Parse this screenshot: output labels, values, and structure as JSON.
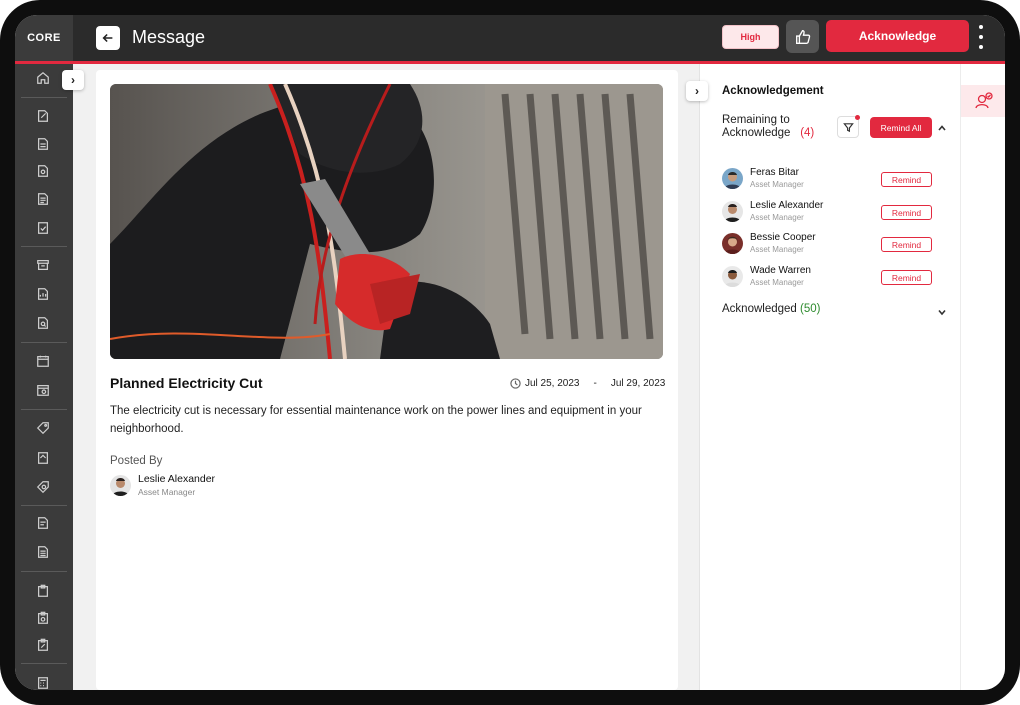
{
  "brand": {
    "logo_text": "CORE",
    "accent": "#e2293f"
  },
  "header": {
    "title": "Message",
    "priority": "High",
    "acknowledge_label": "Acknowledge"
  },
  "sidebar": {
    "icons": [
      "home-icon",
      "edit-document-icon",
      "document-icon",
      "document-settings-icon",
      "document-list-icon",
      "document-check-icon",
      "archive-icon",
      "report-icon",
      "report-search-icon",
      "calendar-document-icon",
      "calendar-search-icon",
      "tag-edit-icon",
      "tag-document-icon",
      "tag-settings-icon",
      "list-edit-icon",
      "list-icon",
      "clipboard-icon",
      "clipboard-search-icon",
      "clipboard-edit-icon",
      "calculator-icon"
    ]
  },
  "post": {
    "title": "Planned Electricity Cut",
    "start_date": "Jul 25, 2023",
    "date_separator": "-",
    "end_date": "Jul 29, 2023",
    "body": "The electricity cut is necessary for essential maintenance work on the power lines and equipment in your neighborhood.",
    "posted_by_label": "Posted By",
    "author": {
      "name": "Leslie Alexander",
      "role": "Asset Manager"
    }
  },
  "acknowledgement": {
    "title": "Acknowledgement",
    "remaining_label": "Remaining to Acknowledge",
    "remaining_count": "(4)",
    "remind_all_label": "Remind All",
    "remind_label": "Remind",
    "people": [
      {
        "name": "Feras Bitar",
        "role": "Asset Manager"
      },
      {
        "name": "Leslie Alexander",
        "role": "Asset Manager"
      },
      {
        "name": "Bessie Cooper",
        "role": "Asset Manager"
      },
      {
        "name": "Wade Warren",
        "role": "Asset Manager"
      }
    ],
    "acknowledged_label": "Acknowledged",
    "acknowledged_count": "(50)"
  }
}
